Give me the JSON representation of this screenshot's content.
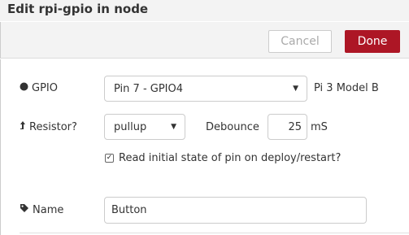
{
  "dialog": {
    "title": "Edit rpi-gpio in node"
  },
  "toolbar": {
    "cancel_label": "Cancel",
    "done_label": "Done"
  },
  "form": {
    "gpio": {
      "icon": "circle-icon",
      "label": "GPIO",
      "selected": "Pin 7 - GPIO4",
      "model": "Pi 3 Model B"
    },
    "resistor": {
      "icon": "level-up-icon",
      "label": "Resistor?",
      "selected": "pullup"
    },
    "debounce": {
      "label": "Debounce",
      "value": "25",
      "unit": "mS"
    },
    "read_initial": {
      "checked": true,
      "label": "Read initial state of pin on deploy/restart?"
    },
    "name": {
      "icon": "tag-icon",
      "label": "Name",
      "value": "Button"
    }
  },
  "colors": {
    "accent": "#ad1625",
    "toolbar_bg": "#f3f3f3"
  }
}
